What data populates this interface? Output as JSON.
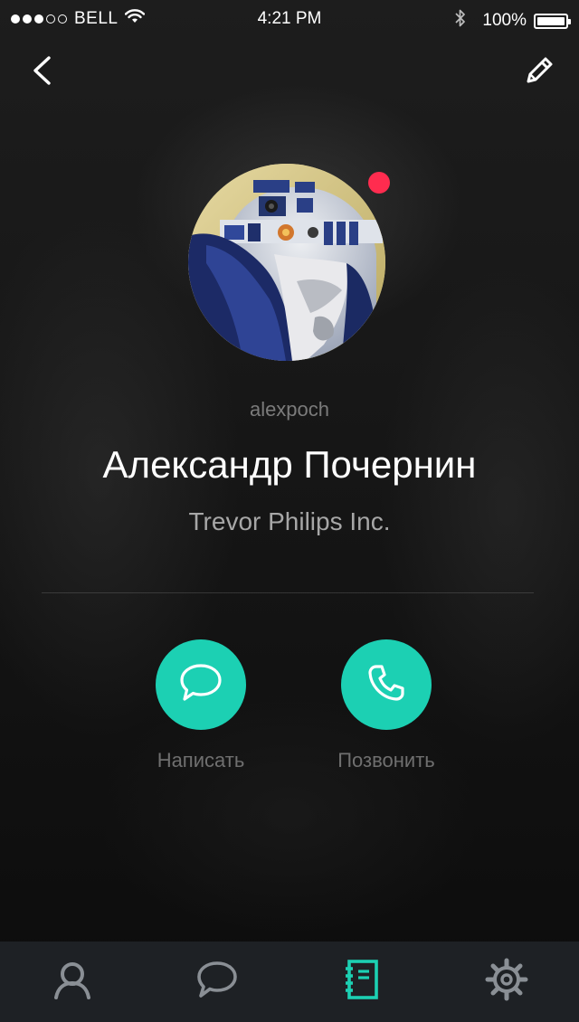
{
  "status_bar": {
    "carrier": "BELL",
    "time": "4:21 PM",
    "battery": "100%",
    "signal_strength": 3,
    "signal_max": 5,
    "battery_level": 1.0,
    "icons": [
      "signal-dots-icon",
      "wifi-icon",
      "bluetooth-icon",
      "battery-icon"
    ]
  },
  "nav": {
    "back_icon": "chevron-left-icon",
    "edit_icon": "pencil-icon"
  },
  "profile": {
    "username": "alexpoch",
    "name": "Александр Почернин",
    "company": "Trevor Philips Inc.",
    "online_indicator_color": "#ff2c4f"
  },
  "actions": [
    {
      "label": "Написать",
      "icon": "chat-bubble-icon"
    },
    {
      "label": "Позвонить",
      "icon": "phone-icon"
    }
  ],
  "tabs": [
    {
      "icon": "person-icon",
      "active": false
    },
    {
      "icon": "chat-icon",
      "active": false
    },
    {
      "icon": "contacts-book-icon",
      "active": true
    },
    {
      "icon": "gear-icon",
      "active": false
    }
  ],
  "colors": {
    "accent": "#1cd0b3",
    "tab_bar_bg": "#1e2125",
    "tab_icon_inactive": "#8a8f95",
    "tab_icon_active": "#1cd0b3"
  }
}
